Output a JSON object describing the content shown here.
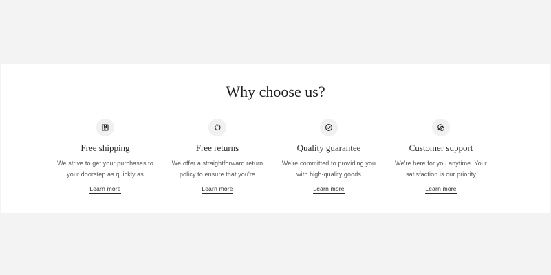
{
  "section": {
    "title": "Why choose us?",
    "features": [
      {
        "icon": "package-icon",
        "title": "Free shipping",
        "description": "We strive to get your purchases to\nyour doorstep as quickly as",
        "link": "Learn more"
      },
      {
        "icon": "return-arrow-icon",
        "title": "Free returns",
        "description": "We offer a straightforward return\npolicy to ensure that you're",
        "link": "Learn more"
      },
      {
        "icon": "check-circle-icon",
        "title": "Quality guarantee",
        "description": "We're committed to providing you\nwith high-quality goods",
        "link": "Learn more"
      },
      {
        "icon": "chat-bubbles-icon",
        "title": "Customer support",
        "description": "We're here for you anytime. Your\nsatisfaction is our priority",
        "link": "Learn more"
      }
    ]
  },
  "colors": {
    "page_background": "#f3f3f3",
    "section_background": "#ffffff",
    "icon_background": "#f1f1f1",
    "text": "#2a2a2a",
    "muted_text": "#555555"
  }
}
